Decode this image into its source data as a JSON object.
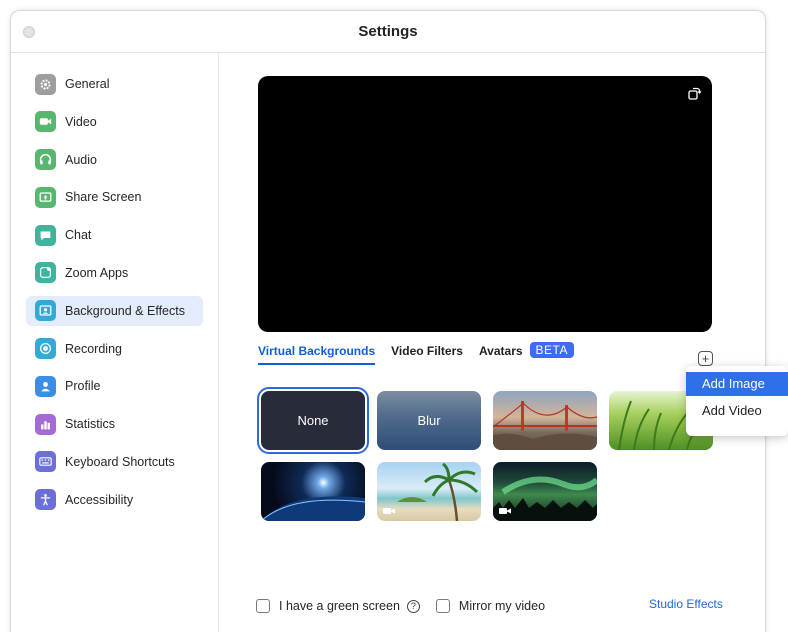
{
  "window": {
    "title": "Settings"
  },
  "sidebar": {
    "items": [
      {
        "label": "General",
        "icon": "gear-icon",
        "color": "#9e9e9e"
      },
      {
        "label": "Video",
        "icon": "video-camera-icon",
        "color": "#57b76f"
      },
      {
        "label": "Audio",
        "icon": "headphones-icon",
        "color": "#57b76f"
      },
      {
        "label": "Share Screen",
        "icon": "share-screen-icon",
        "color": "#57b76f"
      },
      {
        "label": "Chat",
        "icon": "chat-bubble-icon",
        "color": "#3fb39e"
      },
      {
        "label": "Zoom Apps",
        "icon": "apps-icon",
        "color": "#3fb39e"
      },
      {
        "label": "Background & Effects",
        "icon": "background-icon",
        "color": "#36a8d6"
      },
      {
        "label": "Recording",
        "icon": "record-icon",
        "color": "#36a8d6"
      },
      {
        "label": "Profile",
        "icon": "person-icon",
        "color": "#3a8ee6"
      },
      {
        "label": "Statistics",
        "icon": "bar-chart-icon",
        "color": "#a56ad6"
      },
      {
        "label": "Keyboard Shortcuts",
        "icon": "keyboard-icon",
        "color": "#6b6fd8"
      },
      {
        "label": "Accessibility",
        "icon": "accessibility-icon",
        "color": "#6b6fd8"
      }
    ],
    "active_index": 6
  },
  "tabs": [
    {
      "label": "Virtual Backgrounds",
      "active": true
    },
    {
      "label": "Video Filters",
      "active": false
    },
    {
      "label": "Avatars",
      "active": false
    }
  ],
  "beta_badge": "BETA",
  "backgrounds": [
    {
      "label": "None",
      "kind": "none",
      "selected": true
    },
    {
      "label": "Blur",
      "kind": "blur",
      "selected": false
    },
    {
      "label": "",
      "kind": "golden-gate",
      "selected": false
    },
    {
      "label": "",
      "kind": "grass",
      "selected": false
    },
    {
      "label": "",
      "kind": "earth",
      "selected": false
    },
    {
      "label": "",
      "kind": "beach-video",
      "selected": false
    },
    {
      "label": "",
      "kind": "aurora-video",
      "selected": false
    }
  ],
  "add_menu": {
    "items": [
      "Add Image",
      "Add Video"
    ],
    "highlighted": 0
  },
  "footer": {
    "green_screen_label": "I have a green screen",
    "mirror_label": "Mirror my video",
    "studio_effects": "Studio Effects"
  },
  "colors": {
    "accent": "#0e5fd8",
    "beta": "#3d6cf2",
    "menu_highlight": "#2f6fe8"
  }
}
